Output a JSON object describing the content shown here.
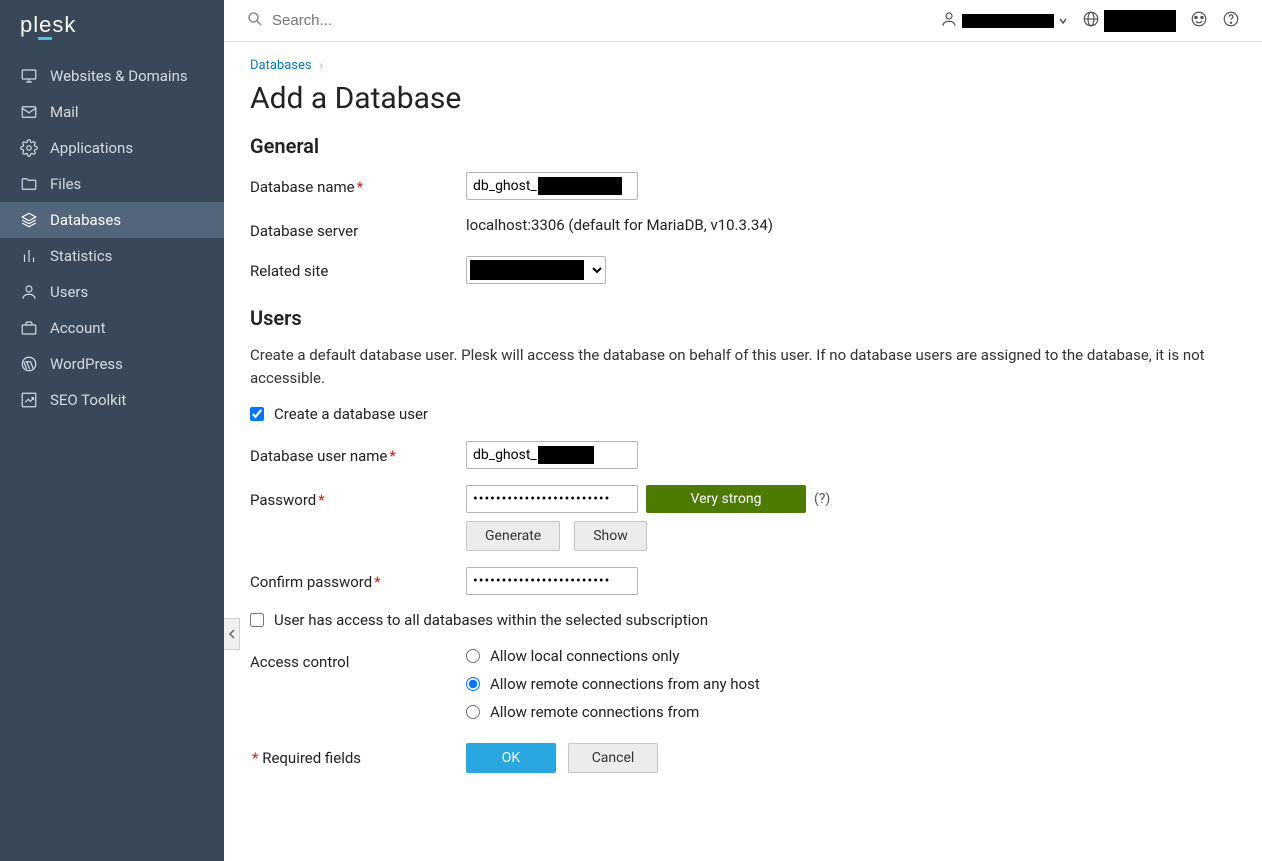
{
  "brand": "plesk",
  "search": {
    "placeholder": "Search..."
  },
  "sidebar": {
    "items": [
      {
        "label": "Websites & Domains"
      },
      {
        "label": "Mail"
      },
      {
        "label": "Applications"
      },
      {
        "label": "Files"
      },
      {
        "label": "Databases"
      },
      {
        "label": "Statistics"
      },
      {
        "label": "Users"
      },
      {
        "label": "Account"
      },
      {
        "label": "WordPress"
      },
      {
        "label": "SEO Toolkit"
      }
    ]
  },
  "breadcrumb": {
    "parent": "Databases"
  },
  "page_title": "Add a Database",
  "sections": {
    "general": {
      "heading": "General",
      "db_name_label": "Database name",
      "db_name_value": "db_ghost_",
      "db_server_label": "Database server",
      "db_server_value": "localhost:3306 (default for MariaDB, v10.3.34)",
      "related_site_label": "Related site"
    },
    "users": {
      "heading": "Users",
      "description": "Create a default database user. Plesk will access the database on behalf of this user. If no database users are assigned to the database, it is not accessible.",
      "create_user_label": "Create a database user",
      "username_label": "Database user name",
      "username_value": "db_ghost_",
      "password_label": "Password",
      "strength_label": "Very strong",
      "help_link": "(?)",
      "generate_btn": "Generate",
      "show_btn": "Show",
      "confirm_label": "Confirm password",
      "all_db_label": "User has access to all databases within the selected subscription",
      "access_label": "Access control",
      "access_options": [
        "Allow local connections only",
        "Allow remote connections from any host",
        "Allow remote connections from"
      ]
    }
  },
  "footer": {
    "required_note": "Required fields",
    "ok": "OK",
    "cancel": "Cancel"
  }
}
